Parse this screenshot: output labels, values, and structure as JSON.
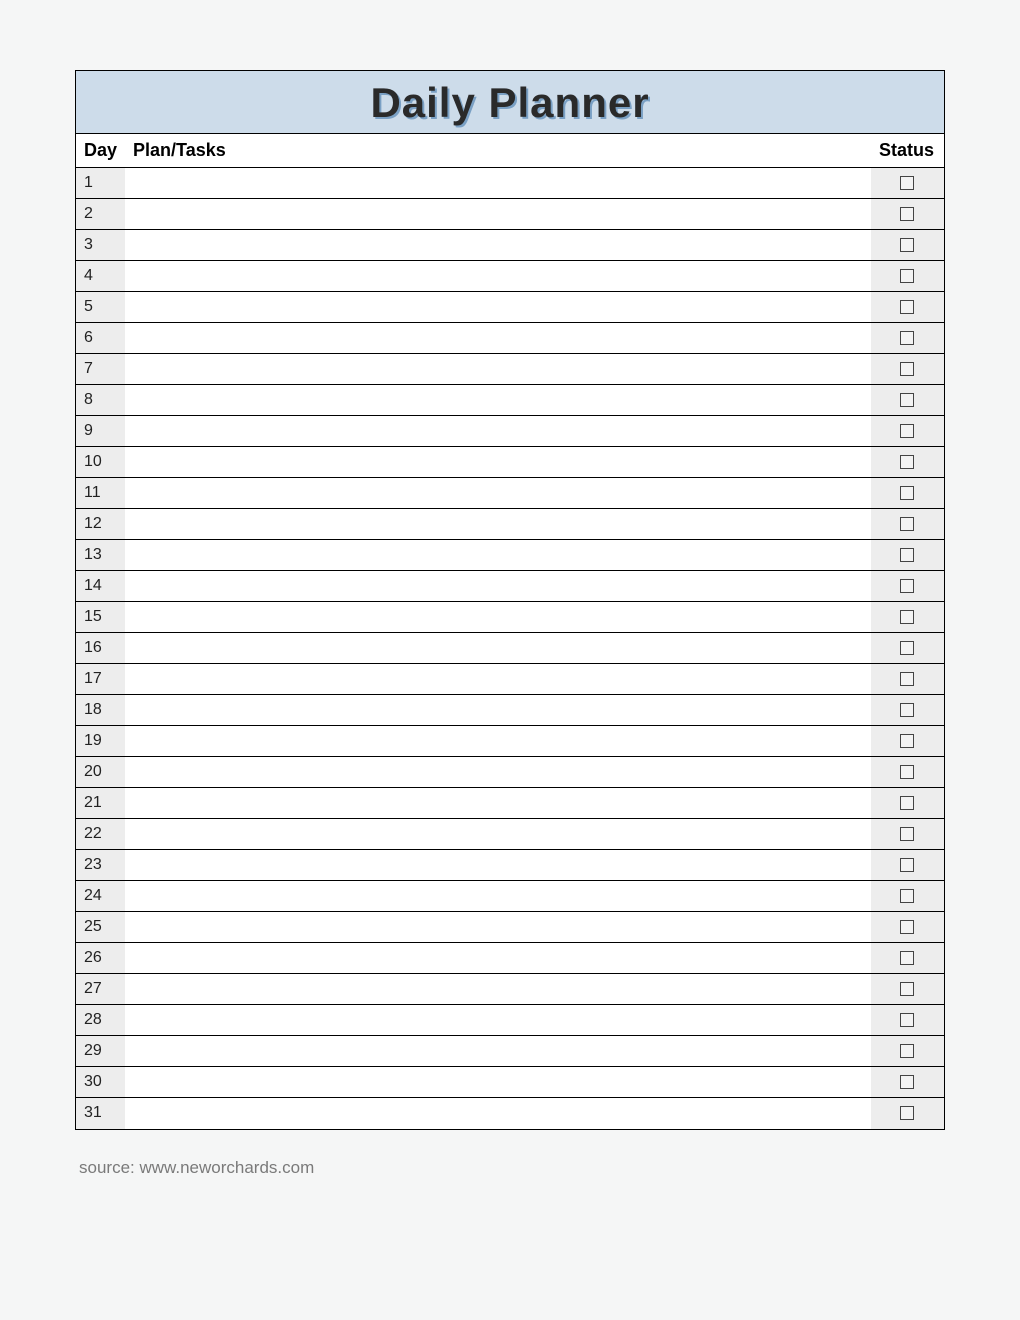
{
  "title": "Daily Planner",
  "columns": {
    "day": "Day",
    "tasks": "Plan/Tasks",
    "status": "Status"
  },
  "rows": [
    {
      "day": "1",
      "task": "",
      "checked": false
    },
    {
      "day": "2",
      "task": "",
      "checked": false
    },
    {
      "day": "3",
      "task": "",
      "checked": false
    },
    {
      "day": "4",
      "task": "",
      "checked": false
    },
    {
      "day": "5",
      "task": "",
      "checked": false
    },
    {
      "day": "6",
      "task": "",
      "checked": false
    },
    {
      "day": "7",
      "task": "",
      "checked": false
    },
    {
      "day": "8",
      "task": "",
      "checked": false
    },
    {
      "day": "9",
      "task": "",
      "checked": false
    },
    {
      "day": "10",
      "task": "",
      "checked": false
    },
    {
      "day": "11",
      "task": "",
      "checked": false
    },
    {
      "day": "12",
      "task": "",
      "checked": false
    },
    {
      "day": "13",
      "task": "",
      "checked": false
    },
    {
      "day": "14",
      "task": "",
      "checked": false
    },
    {
      "day": "15",
      "task": "",
      "checked": false
    },
    {
      "day": "16",
      "task": "",
      "checked": false
    },
    {
      "day": "17",
      "task": "",
      "checked": false
    },
    {
      "day": "18",
      "task": "",
      "checked": false
    },
    {
      "day": "19",
      "task": "",
      "checked": false
    },
    {
      "day": "20",
      "task": "",
      "checked": false
    },
    {
      "day": "21",
      "task": "",
      "checked": false
    },
    {
      "day": "22",
      "task": "",
      "checked": false
    },
    {
      "day": "23",
      "task": "",
      "checked": false
    },
    {
      "day": "24",
      "task": "",
      "checked": false
    },
    {
      "day": "25",
      "task": "",
      "checked": false
    },
    {
      "day": "26",
      "task": "",
      "checked": false
    },
    {
      "day": "27",
      "task": "",
      "checked": false
    },
    {
      "day": "28",
      "task": "",
      "checked": false
    },
    {
      "day": "29",
      "task": "",
      "checked": false
    },
    {
      "day": "30",
      "task": "",
      "checked": false
    },
    {
      "day": "31",
      "task": "",
      "checked": false
    }
  ],
  "source": "source: www.neworchards.com"
}
